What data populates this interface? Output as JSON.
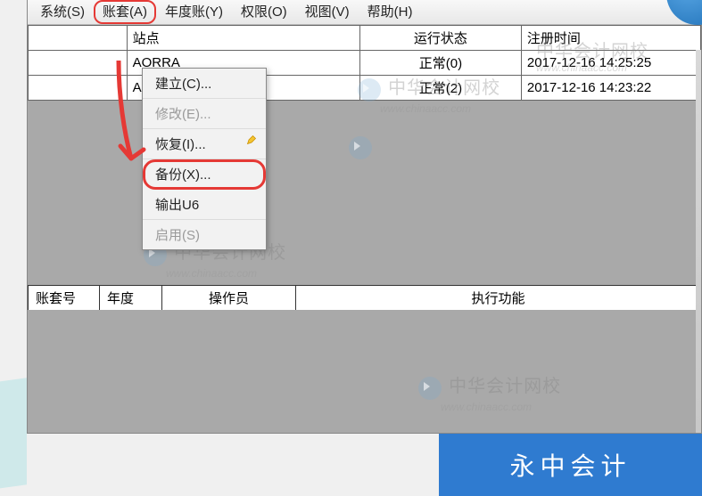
{
  "menubar": {
    "items": [
      {
        "label": "系统(S)"
      },
      {
        "label": "账套(A)"
      },
      {
        "label": "年度账(Y)"
      },
      {
        "label": "权限(O)"
      },
      {
        "label": "视图(V)"
      },
      {
        "label": "帮助(H)"
      }
    ]
  },
  "dropdown": {
    "items": [
      {
        "label": "建立(C)...",
        "disabled": false
      },
      {
        "label": "修改(E)...",
        "disabled": true
      },
      {
        "label": "恢复(I)...",
        "disabled": false,
        "pencil": true
      },
      {
        "label": "备份(X)...",
        "disabled": false,
        "marked": true
      },
      {
        "label": "输出U6",
        "disabled": false
      },
      {
        "label": "启用(S)",
        "disabled": true
      }
    ]
  },
  "table": {
    "headers": {
      "col1": "",
      "col2": "站点",
      "col3": "运行状态",
      "col4": "注册时间"
    },
    "rows": [
      {
        "c1": "",
        "c2": "AORRA",
        "c3": "正常(0)",
        "c4": "2017-12-16 14:25:25"
      },
      {
        "c1": "",
        "c2": "AORRA",
        "c3": "正常(2)",
        "c4": "2017-12-16 14:23:22"
      }
    ]
  },
  "status_table": {
    "headers": {
      "h1": "账套号",
      "h2": "年度",
      "h3": "操作员",
      "h4": "执行功能"
    }
  },
  "watermark": {
    "title": "中华会计网校",
    "url": "www.chinaacc.com"
  },
  "brand": {
    "label": "永中会计"
  }
}
